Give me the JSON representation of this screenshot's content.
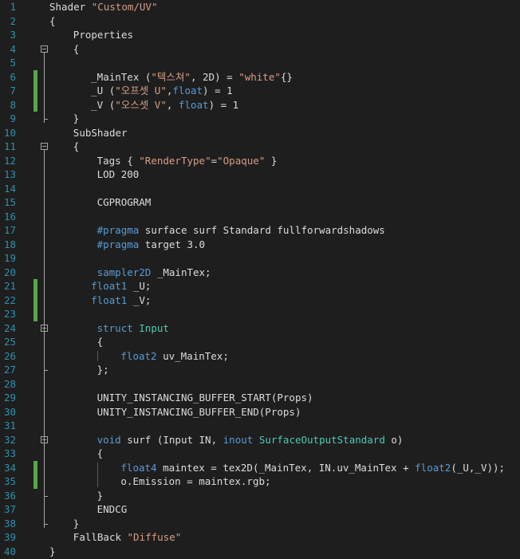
{
  "editor": {
    "colors": {
      "background": "#1e1e1e",
      "line_number": "#2b91af",
      "keyword": "#569cd6",
      "string": "#d69d85",
      "type": "#4ec9b0",
      "text": "#dcdcdc",
      "change_marker": "#57a64a"
    },
    "lines": [
      {
        "n": "1",
        "indent": 0,
        "changed": false,
        "fold": false,
        "tokens": [
          [
            "plain",
            "Shader "
          ],
          [
            "str",
            "\"Custom/UV\""
          ]
        ]
      },
      {
        "n": "2",
        "indent": 0,
        "changed": false,
        "fold": false,
        "tokens": [
          [
            "plain",
            "{"
          ]
        ]
      },
      {
        "n": "3",
        "indent": 4,
        "changed": false,
        "fold": false,
        "tokens": [
          [
            "plain",
            "Properties"
          ]
        ]
      },
      {
        "n": "4",
        "indent": 4,
        "changed": false,
        "fold": true,
        "tokens": [
          [
            "plain",
            "{"
          ]
        ]
      },
      {
        "n": "5",
        "indent": 0,
        "changed": false,
        "fold": false,
        "tokens": []
      },
      {
        "n": "6",
        "indent": 7,
        "changed": true,
        "fold": false,
        "tokens": [
          [
            "plain",
            "_MainTex ("
          ],
          [
            "str",
            "\"텍스쳐\""
          ],
          [
            "plain",
            ", 2D) = "
          ],
          [
            "str",
            "\"white\""
          ],
          [
            "plain",
            "{}"
          ]
        ]
      },
      {
        "n": "7",
        "indent": 7,
        "changed": true,
        "fold": false,
        "tokens": [
          [
            "plain",
            "_U ("
          ],
          [
            "str",
            "\"오프셋 U\""
          ],
          [
            "plain",
            ","
          ],
          [
            "kw",
            "float"
          ],
          [
            "plain",
            ") = 1"
          ]
        ]
      },
      {
        "n": "8",
        "indent": 7,
        "changed": true,
        "fold": false,
        "tokens": [
          [
            "plain",
            "_V ("
          ],
          [
            "str",
            "\"오스셋 V\""
          ],
          [
            "plain",
            ", "
          ],
          [
            "kw",
            "float"
          ],
          [
            "plain",
            ") = 1"
          ]
        ]
      },
      {
        "n": "9",
        "indent": 4,
        "changed": false,
        "fold": false,
        "tokens": [
          [
            "plain",
            "}"
          ]
        ]
      },
      {
        "n": "10",
        "indent": 4,
        "changed": false,
        "fold": false,
        "tokens": [
          [
            "plain",
            "SubShader"
          ]
        ]
      },
      {
        "n": "11",
        "indent": 4,
        "changed": false,
        "fold": true,
        "tokens": [
          [
            "plain",
            "{"
          ]
        ]
      },
      {
        "n": "12",
        "indent": 8,
        "changed": false,
        "fold": false,
        "tokens": [
          [
            "plain",
            "Tags { "
          ],
          [
            "str",
            "\"RenderType\""
          ],
          [
            "plain",
            "="
          ],
          [
            "str",
            "\"Opaque\""
          ],
          [
            "plain",
            " }"
          ]
        ]
      },
      {
        "n": "13",
        "indent": 8,
        "changed": false,
        "fold": false,
        "tokens": [
          [
            "plain",
            "LOD 200"
          ]
        ]
      },
      {
        "n": "14",
        "indent": 0,
        "changed": false,
        "fold": false,
        "tokens": []
      },
      {
        "n": "15",
        "indent": 8,
        "changed": false,
        "fold": false,
        "tokens": [
          [
            "plain",
            "CGPROGRAM"
          ]
        ]
      },
      {
        "n": "16",
        "indent": 0,
        "changed": false,
        "fold": false,
        "tokens": []
      },
      {
        "n": "17",
        "indent": 8,
        "changed": false,
        "fold": false,
        "tokens": [
          [
            "kw",
            "#pragma"
          ],
          [
            "plain",
            " surface surf Standard fullforwardshadows"
          ]
        ]
      },
      {
        "n": "18",
        "indent": 8,
        "changed": false,
        "fold": false,
        "tokens": [
          [
            "kw",
            "#pragma"
          ],
          [
            "plain",
            " target 3.0"
          ]
        ]
      },
      {
        "n": "19",
        "indent": 0,
        "changed": false,
        "fold": false,
        "tokens": []
      },
      {
        "n": "20",
        "indent": 8,
        "changed": false,
        "fold": false,
        "tokens": [
          [
            "kw",
            "sampler2D"
          ],
          [
            "plain",
            " _MainTex;"
          ]
        ]
      },
      {
        "n": "21",
        "indent": 7,
        "changed": true,
        "fold": false,
        "tokens": [
          [
            "kw",
            "float1"
          ],
          [
            "plain",
            " _U;"
          ]
        ]
      },
      {
        "n": "22",
        "indent": 7,
        "changed": true,
        "fold": false,
        "tokens": [
          [
            "kw",
            "float1"
          ],
          [
            "plain",
            " _V;"
          ]
        ]
      },
      {
        "n": "23",
        "indent": 0,
        "changed": true,
        "fold": false,
        "tokens": []
      },
      {
        "n": "24",
        "indent": 8,
        "changed": false,
        "fold": true,
        "tokens": [
          [
            "kw",
            "struct"
          ],
          [
            "plain",
            " "
          ],
          [
            "type",
            "Input"
          ]
        ]
      },
      {
        "n": "25",
        "indent": 8,
        "changed": false,
        "fold": false,
        "tokens": [
          [
            "plain",
            "{"
          ]
        ]
      },
      {
        "n": "26",
        "indent": 12,
        "changed": false,
        "fold": false,
        "tokens": [
          [
            "kw",
            "float2"
          ],
          [
            "plain",
            " uv_MainTex;"
          ]
        ]
      },
      {
        "n": "27",
        "indent": 8,
        "changed": false,
        "fold": false,
        "tokens": [
          [
            "plain",
            "};"
          ]
        ]
      },
      {
        "n": "28",
        "indent": 0,
        "changed": false,
        "fold": false,
        "tokens": []
      },
      {
        "n": "29",
        "indent": 8,
        "changed": false,
        "fold": false,
        "tokens": [
          [
            "plain",
            "UNITY_INSTANCING_BUFFER_START(Props)"
          ]
        ]
      },
      {
        "n": "30",
        "indent": 8,
        "changed": false,
        "fold": false,
        "tokens": [
          [
            "plain",
            "UNITY_INSTANCING_BUFFER_END(Props)"
          ]
        ]
      },
      {
        "n": "31",
        "indent": 0,
        "changed": false,
        "fold": false,
        "tokens": []
      },
      {
        "n": "32",
        "indent": 8,
        "changed": false,
        "fold": true,
        "tokens": [
          [
            "kw",
            "void"
          ],
          [
            "plain",
            " surf (Input IN, "
          ],
          [
            "kw",
            "inout"
          ],
          [
            "plain",
            " "
          ],
          [
            "type",
            "SurfaceOutputStandard"
          ],
          [
            "plain",
            " o)"
          ]
        ]
      },
      {
        "n": "33",
        "indent": 8,
        "changed": false,
        "fold": false,
        "tokens": [
          [
            "plain",
            "{"
          ]
        ]
      },
      {
        "n": "34",
        "indent": 12,
        "changed": true,
        "fold": false,
        "tokens": [
          [
            "kw",
            "float4"
          ],
          [
            "plain",
            " maintex = tex2D(_MainTex, IN.uv_MainTex + "
          ],
          [
            "kw",
            "float2"
          ],
          [
            "plain",
            "(_U,_V));"
          ]
        ]
      },
      {
        "n": "35",
        "indent": 12,
        "changed": true,
        "fold": false,
        "tokens": [
          [
            "plain",
            "o.Emission = maintex.rgb;"
          ]
        ]
      },
      {
        "n": "36",
        "indent": 8,
        "changed": false,
        "fold": false,
        "tokens": [
          [
            "plain",
            "}"
          ]
        ]
      },
      {
        "n": "37",
        "indent": 8,
        "changed": false,
        "fold": false,
        "tokens": [
          [
            "plain",
            "ENDCG"
          ]
        ]
      },
      {
        "n": "38",
        "indent": 4,
        "changed": false,
        "fold": false,
        "tokens": [
          [
            "plain",
            "}"
          ]
        ]
      },
      {
        "n": "39",
        "indent": 4,
        "changed": false,
        "fold": false,
        "tokens": [
          [
            "plain",
            "FallBack "
          ],
          [
            "str",
            "\"Diffuse\""
          ]
        ]
      },
      {
        "n": "40",
        "indent": 0,
        "changed": false,
        "fold": false,
        "tokens": [
          [
            "plain",
            "}"
          ]
        ]
      }
    ]
  }
}
